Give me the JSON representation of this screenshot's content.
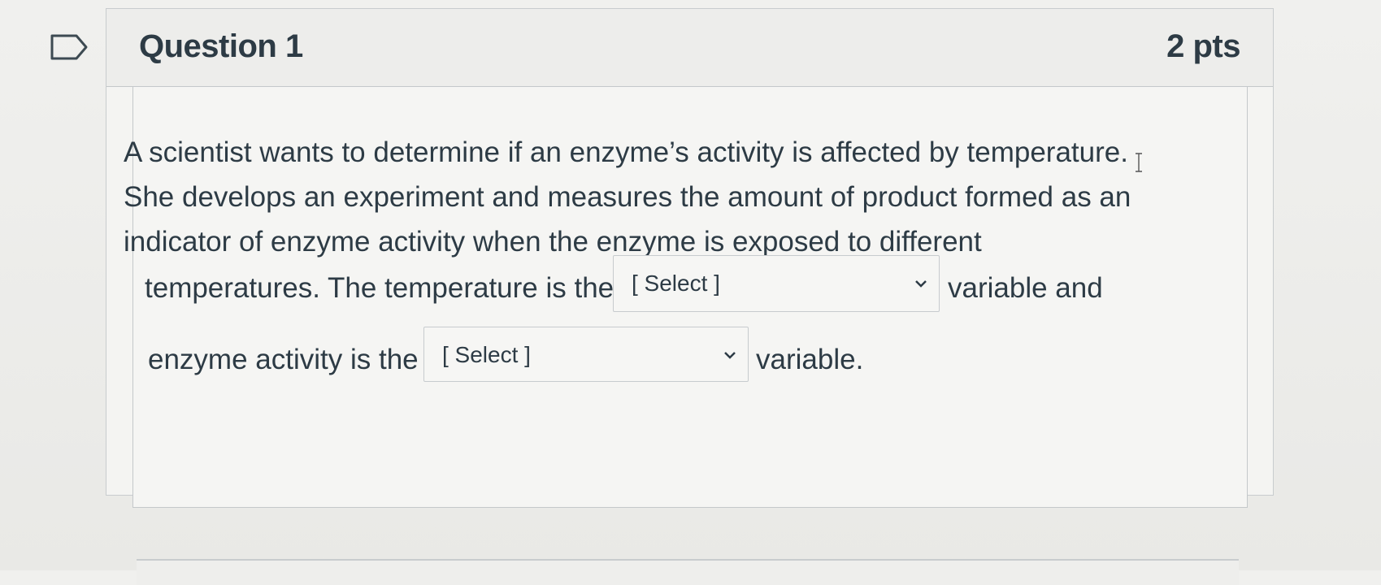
{
  "question": {
    "title": "Question 1",
    "points": "2 pts",
    "flag_icon": "bookmark-flag-icon",
    "text_lines": [
      "A scientist wants to determine if an enzyme’s activity is affected by temperature.",
      "She develops an experiment and measures the amount of product formed as an",
      "indicator of enzyme activity when the enzyme is exposed to different"
    ],
    "line4_before": "temperatures. The temperature is the",
    "line4_after": "variable and",
    "line5_before": "enzyme activity is the",
    "line5_after": "variable.",
    "dropdown1": {
      "selected": "[ Select ]",
      "icon": "chevron-down-icon"
    },
    "dropdown2": {
      "selected": "[ Select ]",
      "icon": "chevron-down-icon"
    }
  },
  "colors": {
    "text": "#2d3b45",
    "border": "#c7cbce",
    "header_bg": "#ededeb",
    "page_bg": "#eeeeec"
  }
}
